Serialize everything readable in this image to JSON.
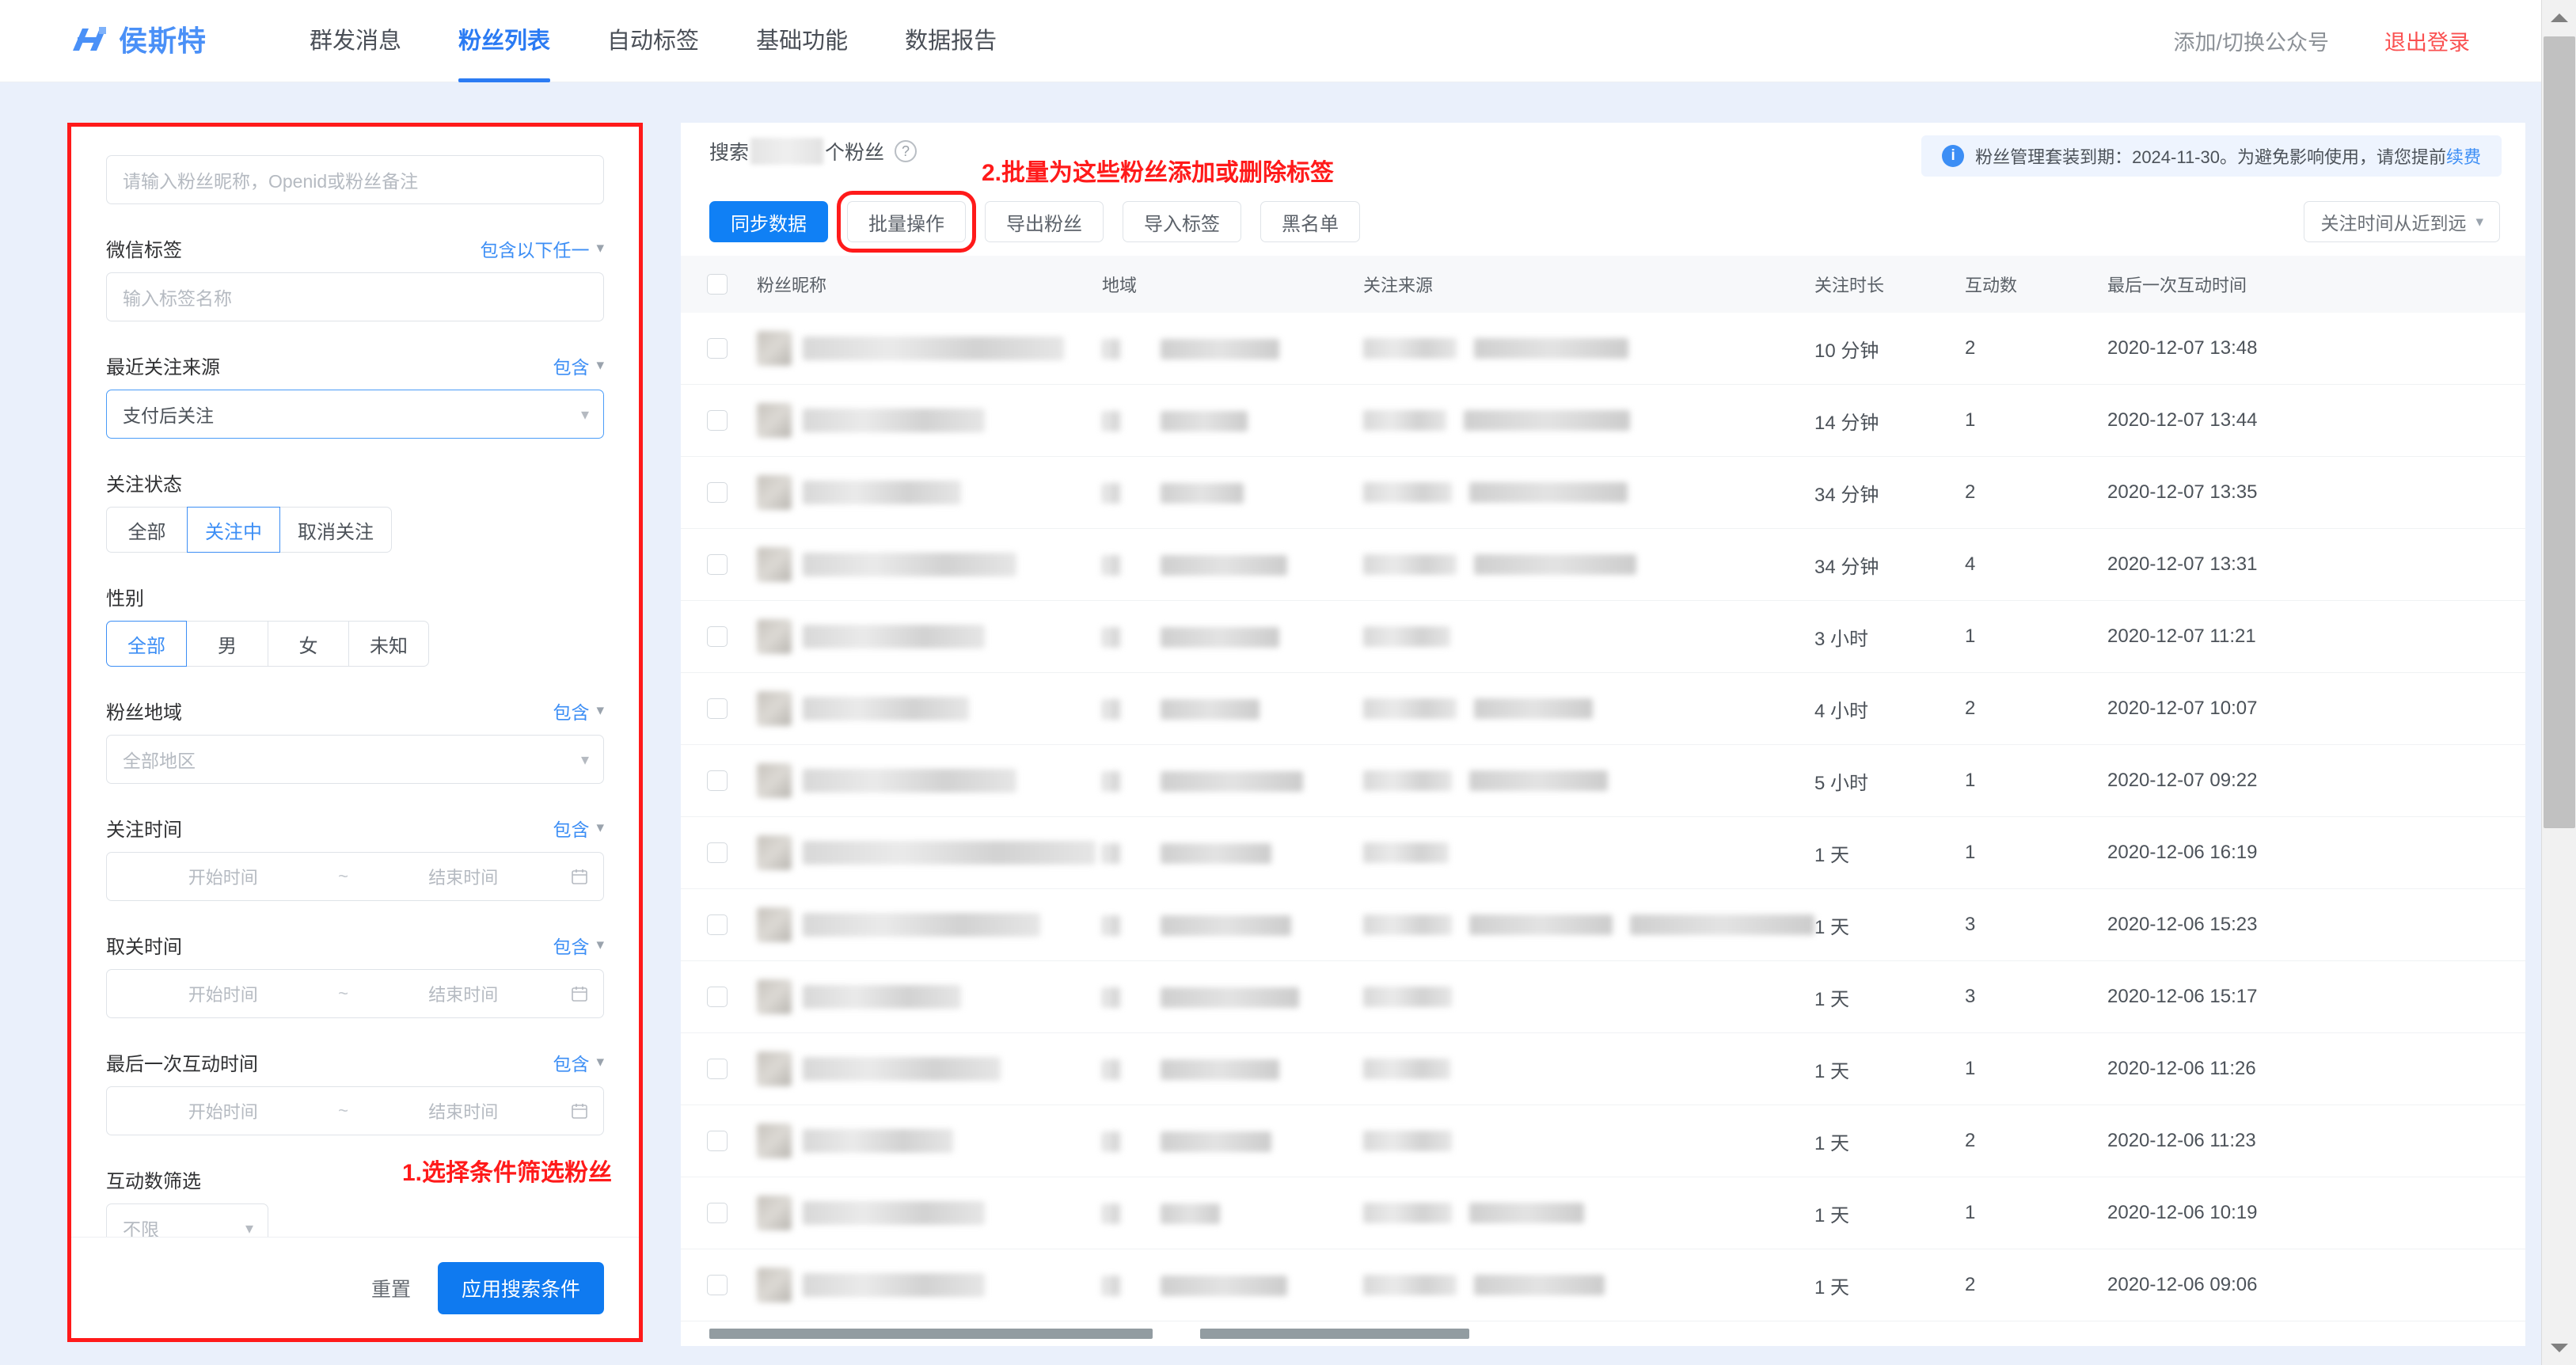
{
  "header": {
    "logo_text": "侯斯特",
    "logo_icon": "h-monogram-logo",
    "nav": [
      {
        "label": "群发消息",
        "active": false
      },
      {
        "label": "粉丝列表",
        "active": true
      },
      {
        "label": "自动标签",
        "active": false
      },
      {
        "label": "基础功能",
        "active": false
      },
      {
        "label": "数据报告",
        "active": false
      }
    ],
    "switch_account": "添加/切换公众号",
    "logout": "退出登录"
  },
  "filter_panel": {
    "keyword_placeholder": "请输入粉丝昵称，Openid或粉丝备注",
    "wechat_tag": {
      "label": "微信标签",
      "mode": "包含以下任一",
      "input_placeholder": "输入标签名称"
    },
    "recent_source": {
      "label": "最近关注来源",
      "mode": "包含",
      "value": "支付后关注"
    },
    "follow_status": {
      "label": "关注状态",
      "options": [
        "全部",
        "关注中",
        "取消关注"
      ],
      "selected": "关注中"
    },
    "gender": {
      "label": "性别",
      "options": [
        "全部",
        "男",
        "女",
        "未知"
      ],
      "selected": "全部"
    },
    "fan_region": {
      "label": "粉丝地域",
      "mode": "包含",
      "placeholder": "全部地区"
    },
    "follow_time": {
      "label": "关注时间",
      "mode": "包含",
      "start_placeholder": "开始时间",
      "separator": "~",
      "end_placeholder": "结束时间",
      "icon": "calendar-icon"
    },
    "unfollow_time": {
      "label": "取关时间",
      "mode": "包含",
      "start_placeholder": "开始时间",
      "separator": "~",
      "end_placeholder": "结束时间",
      "icon": "calendar-icon"
    },
    "last_interaction_time": {
      "label": "最后一次互动时间",
      "mode": "包含",
      "start_placeholder": "开始时间",
      "separator": "~",
      "end_placeholder": "结束时间",
      "icon": "calendar-icon"
    },
    "interaction_count": {
      "label": "互动数筛选",
      "placeholder": "不限"
    },
    "annotation": "1.选择条件筛选粉丝",
    "reset_label": "重置",
    "apply_label": "应用搜索条件"
  },
  "content": {
    "search_prefix": "搜索",
    "search_suffix": "个粉丝",
    "help_icon": "question-mark-icon",
    "annotation": "2.批量为这些粉丝添加或删除标签",
    "alert": {
      "icon": "info-icon",
      "text": "粉丝管理套装到期：2024-11-30。为避免影响使用，请您提前",
      "link": "续费"
    },
    "toolbar": {
      "sync_label": "同步数据",
      "batch_label": "批量操作",
      "export_label": "导出粉丝",
      "import_label": "导入标签",
      "blacklist_label": "黑名单",
      "sort_label": "关注时间从近到远"
    },
    "table": {
      "columns": [
        "粉丝昵称",
        "地域",
        "关注来源",
        "关注时长",
        "互动数",
        "最后一次互动时间"
      ],
      "rows": [
        {
          "nickname": "",
          "region": "",
          "source": "",
          "duration": "10 分钟",
          "interactions": "2",
          "last_interaction": "2020-12-07 13:48"
        },
        {
          "nickname": "",
          "region": "",
          "source": "",
          "duration": "14 分钟",
          "interactions": "1",
          "last_interaction": "2020-12-07 13:44"
        },
        {
          "nickname": "",
          "region": "",
          "source": "",
          "duration": "34 分钟",
          "interactions": "2",
          "last_interaction": "2020-12-07 13:35"
        },
        {
          "nickname": "",
          "region": "",
          "source": "",
          "duration": "34 分钟",
          "interactions": "4",
          "last_interaction": "2020-12-07 13:31"
        },
        {
          "nickname": "",
          "region": "",
          "source": "",
          "duration": "3 小时",
          "interactions": "1",
          "last_interaction": "2020-12-07 11:21"
        },
        {
          "nickname": "",
          "region": "",
          "source": "",
          "duration": "4 小时",
          "interactions": "2",
          "last_interaction": "2020-12-07 10:07"
        },
        {
          "nickname": "",
          "region": "",
          "source": "",
          "duration": "5 小时",
          "interactions": "1",
          "last_interaction": "2020-12-07 09:22"
        },
        {
          "nickname": "",
          "region": "",
          "source": "",
          "duration": "1 天",
          "interactions": "1",
          "last_interaction": "2020-12-06 16:19"
        },
        {
          "nickname": "",
          "region": "",
          "source": "",
          "duration": "1 天",
          "interactions": "3",
          "last_interaction": "2020-12-06 15:23"
        },
        {
          "nickname": "",
          "region": "",
          "source": "",
          "duration": "1 天",
          "interactions": "3",
          "last_interaction": "2020-12-06 15:17"
        },
        {
          "nickname": "",
          "region": "",
          "source": "",
          "duration": "1 天",
          "interactions": "1",
          "last_interaction": "2020-12-06 11:26"
        },
        {
          "nickname": "",
          "region": "",
          "source": "",
          "duration": "1 天",
          "interactions": "2",
          "last_interaction": "2020-12-06 11:23"
        },
        {
          "nickname": "",
          "region": "",
          "source": "",
          "duration": "1 天",
          "interactions": "1",
          "last_interaction": "2020-12-06 10:19"
        },
        {
          "nickname": "",
          "region": "",
          "source": "",
          "duration": "1 天",
          "interactions": "2",
          "last_interaction": "2020-12-06 09:06"
        }
      ]
    }
  },
  "colors": {
    "accent": "#2b7bf3",
    "primary_button": "#1080f5",
    "annotation_red": "#ff1a1a",
    "logout_red": "#fa5151",
    "page_bg": "#eaf0fb"
  }
}
